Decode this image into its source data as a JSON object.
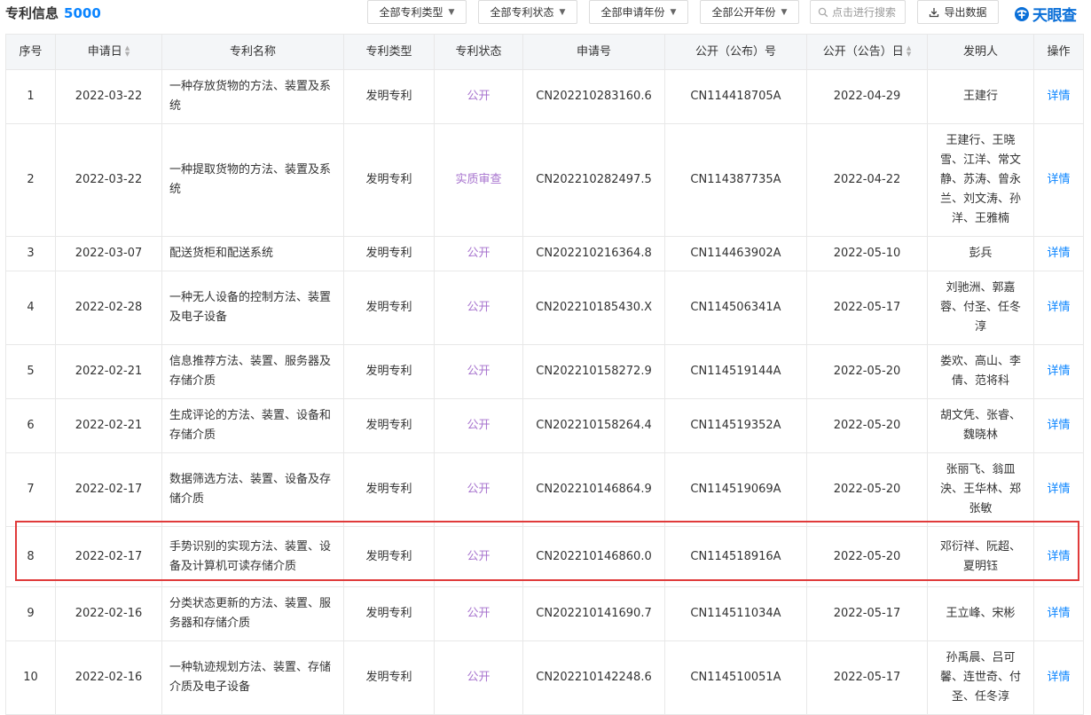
{
  "header": {
    "title": "专利信息",
    "count": "5000",
    "filters": [
      "全部专利类型",
      "全部专利状态",
      "全部申请年份",
      "全部公开年份"
    ],
    "search_placeholder": "点击进行搜索",
    "export_label": "导出数据",
    "logo_text": "天眼查"
  },
  "table": {
    "columns": [
      "序号",
      "申请日",
      "专利名称",
      "专利类型",
      "专利状态",
      "申请号",
      "公开（公布）号",
      "公开（公告）日",
      "发明人",
      "操作"
    ],
    "rows": [
      {
        "no": "1",
        "apply_date": "2022-03-22",
        "name": "一种存放货物的方法、装置及系统",
        "type": "发明专利",
        "status": "公开",
        "apply_no": "CN202210283160.6",
        "pub_no": "CN114418705A",
        "pub_date": "2022-04-29",
        "inventors": "王建行",
        "action": "详情"
      },
      {
        "no": "2",
        "apply_date": "2022-03-22",
        "name": "一种提取货物的方法、装置及系统",
        "type": "发明专利",
        "status": "实质审查",
        "apply_no": "CN202210282497.5",
        "pub_no": "CN114387735A",
        "pub_date": "2022-04-22",
        "inventors": "王建行、王晓雪、江洋、常文静、苏涛、曾永兰、刘文涛、孙洋、王雅楠",
        "action": "详情"
      },
      {
        "no": "3",
        "apply_date": "2022-03-07",
        "name": "配送货柜和配送系统",
        "type": "发明专利",
        "status": "公开",
        "apply_no": "CN202210216364.8",
        "pub_no": "CN114463902A",
        "pub_date": "2022-05-10",
        "inventors": "彭兵",
        "action": "详情"
      },
      {
        "no": "4",
        "apply_date": "2022-02-28",
        "name": "一种无人设备的控制方法、装置及电子设备",
        "type": "发明专利",
        "status": "公开",
        "apply_no": "CN202210185430.X",
        "pub_no": "CN114506341A",
        "pub_date": "2022-05-17",
        "inventors": "刘驰洲、郭嘉蓉、付圣、任冬淳",
        "action": "详情"
      },
      {
        "no": "5",
        "apply_date": "2022-02-21",
        "name": "信息推荐方法、装置、服务器及存储介质",
        "type": "发明专利",
        "status": "公开",
        "apply_no": "CN202210158272.9",
        "pub_no": "CN114519144A",
        "pub_date": "2022-05-20",
        "inventors": "娄欢、高山、李倩、范将科",
        "action": "详情"
      },
      {
        "no": "6",
        "apply_date": "2022-02-21",
        "name": "生成评论的方法、装置、设备和存储介质",
        "type": "发明专利",
        "status": "公开",
        "apply_no": "CN202210158264.4",
        "pub_no": "CN114519352A",
        "pub_date": "2022-05-20",
        "inventors": "胡文凭、张睿、魏晓林",
        "action": "详情"
      },
      {
        "no": "7",
        "apply_date": "2022-02-17",
        "name": "数据筛选方法、装置、设备及存储介质",
        "type": "发明专利",
        "status": "公开",
        "apply_no": "CN202210146864.9",
        "pub_no": "CN114519069A",
        "pub_date": "2022-05-20",
        "inventors": "张丽飞、翁皿泱、王华林、郑张敏",
        "action": "详情"
      },
      {
        "no": "8",
        "apply_date": "2022-02-17",
        "name": "手势识别的实现方法、装置、设备及计算机可读存储介质",
        "type": "发明专利",
        "status": "公开",
        "apply_no": "CN202210146860.0",
        "pub_no": "CN114518916A",
        "pub_date": "2022-05-20",
        "inventors": "邓衍祥、阮超、夏明钰",
        "action": "详情"
      },
      {
        "no": "9",
        "apply_date": "2022-02-16",
        "name": "分类状态更新的方法、装置、服务器和存储介质",
        "type": "发明专利",
        "status": "公开",
        "apply_no": "CN202210141690.7",
        "pub_no": "CN114511034A",
        "pub_date": "2022-05-17",
        "inventors": "王立峰、宋彬",
        "action": "详情"
      },
      {
        "no": "10",
        "apply_date": "2022-02-16",
        "name": "一种轨迹规划方法、装置、存储介质及电子设备",
        "type": "发明专利",
        "status": "公开",
        "apply_no": "CN202210142248.6",
        "pub_no": "CN114510051A",
        "pub_date": "2022-05-17",
        "inventors": "孙禹晨、吕可馨、连世奇、付圣、任冬淳",
        "action": "详情"
      }
    ]
  },
  "colors": {
    "accent": "#0a84ff",
    "status": "#a773ce",
    "header_bg": "#f4f6f8",
    "highlight": "#e03b3b",
    "logo": "#0a6fd8"
  },
  "icons": {
    "search": "search-icon",
    "export": "download-icon",
    "logo": "tianyancha-logo-icon",
    "sort": "sort-icon",
    "caret": "caret-down-icon"
  }
}
